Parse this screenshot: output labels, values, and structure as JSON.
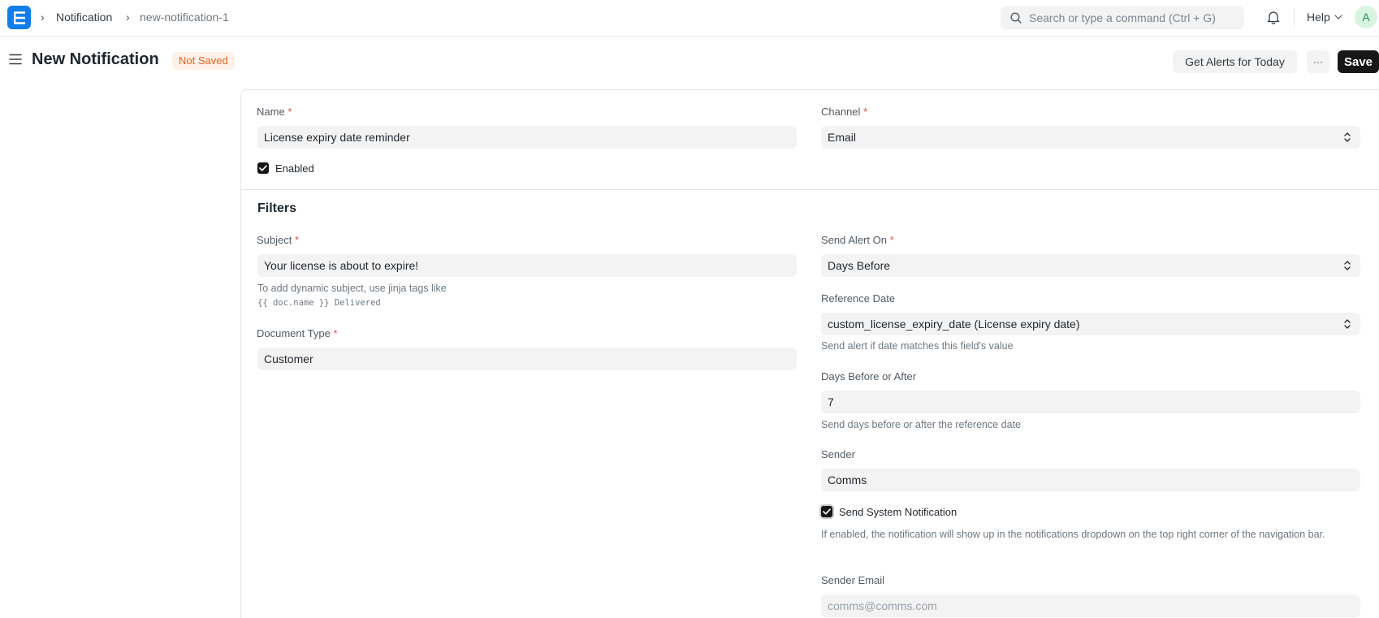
{
  "navbar": {
    "breadcrumbs": [
      "Notification",
      "new-notification-1"
    ],
    "search_placeholder": "Search or type a command (Ctrl + G)",
    "help_label": "Help",
    "avatar_initial": "A"
  },
  "page": {
    "title": "New Notification",
    "status": "Not Saved",
    "get_alerts_label": "Get Alerts for Today",
    "more_label": "···",
    "save_label": "Save"
  },
  "form": {
    "name": {
      "label": "Name",
      "value": "License expiry date reminder"
    },
    "channel": {
      "label": "Channel",
      "value": "Email"
    },
    "enabled": {
      "label": "Enabled",
      "checked": true
    },
    "filters_title": "Filters",
    "subject": {
      "label": "Subject",
      "value": "Your license is about to expire!",
      "help": "To add dynamic subject, use jinja tags like",
      "help_code": "{{ doc.name }} Delivered"
    },
    "document_type": {
      "label": "Document Type",
      "value": "Customer"
    },
    "send_alert_on": {
      "label": "Send Alert On",
      "value": "Days Before"
    },
    "reference_date": {
      "label": "Reference Date",
      "value": "custom_license_expiry_date (License expiry date)",
      "help": "Send alert if date matches this field's value"
    },
    "days_before_after": {
      "label": "Days Before or After",
      "value": "7",
      "help": "Send days before or after the reference date"
    },
    "sender": {
      "label": "Sender",
      "value": "Comms"
    },
    "send_system_notification": {
      "label": "Send System Notification",
      "checked": true,
      "help": "If enabled, the notification will show up in the notifications dropdown on the top right corner of the navigation bar."
    },
    "sender_email": {
      "label": "Sender Email",
      "placeholder": "comms@comms.com"
    },
    "required_marker": "*"
  },
  "colors": {
    "accent": "#0f7eeb",
    "primary_button": "#171717",
    "status_badge_bg": "#fff1e7",
    "status_badge_text": "#e2621c",
    "required": "#e24c4c"
  },
  "icons": {
    "app_logo": "logo-icon",
    "search": "search-icon",
    "notifications": "bell-icon",
    "sidebar_toggle": "hamburger-icon",
    "select": "select-arrows-icon",
    "checkbox": "check-icon"
  }
}
